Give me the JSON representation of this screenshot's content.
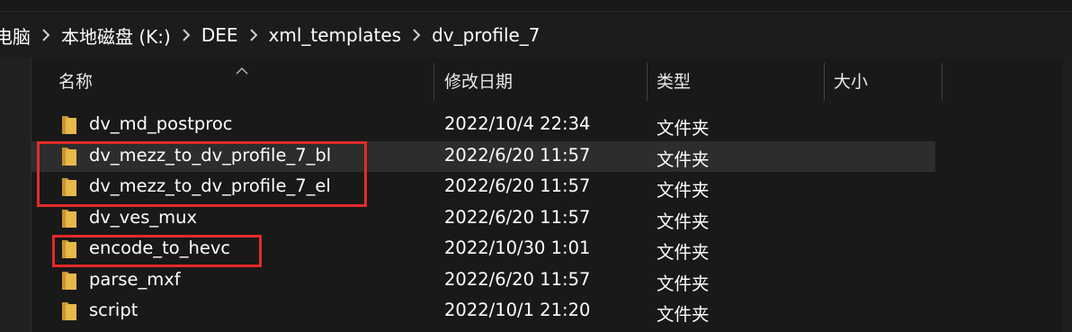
{
  "breadcrumb": {
    "items": [
      "电脑",
      "本地磁盘 (K:)",
      "DEE",
      "xml_templates",
      "dv_profile_7"
    ]
  },
  "columns": {
    "name": "名称",
    "date": "修改日期",
    "type": "类型",
    "size": "大小"
  },
  "rows": [
    {
      "name": "dv_md_postproc",
      "date": "2022/10/4 22:34",
      "type": "文件夹"
    },
    {
      "name": "dv_mezz_to_dv_profile_7_bl",
      "date": "2022/6/20 11:57",
      "type": "文件夹"
    },
    {
      "name": "dv_mezz_to_dv_profile_7_el",
      "date": "2022/6/20 11:57",
      "type": "文件夹"
    },
    {
      "name": "dv_ves_mux",
      "date": "2022/6/20 11:57",
      "type": "文件夹"
    },
    {
      "name": "encode_to_hevc",
      "date": "2022/10/30 1:01",
      "type": "文件夹"
    },
    {
      "name": "parse_mxf",
      "date": "2022/6/20 11:57",
      "type": "文件夹"
    },
    {
      "name": "script",
      "date": "2022/10/1 21:20",
      "type": "文件夹"
    }
  ],
  "colors": {
    "background": "#191919",
    "folder": "#e8b84a",
    "highlight": "#e32a2a"
  },
  "icons": {
    "folder": "folder-icon",
    "separator": "chevron-right-icon",
    "sort": "sort-up-icon"
  }
}
